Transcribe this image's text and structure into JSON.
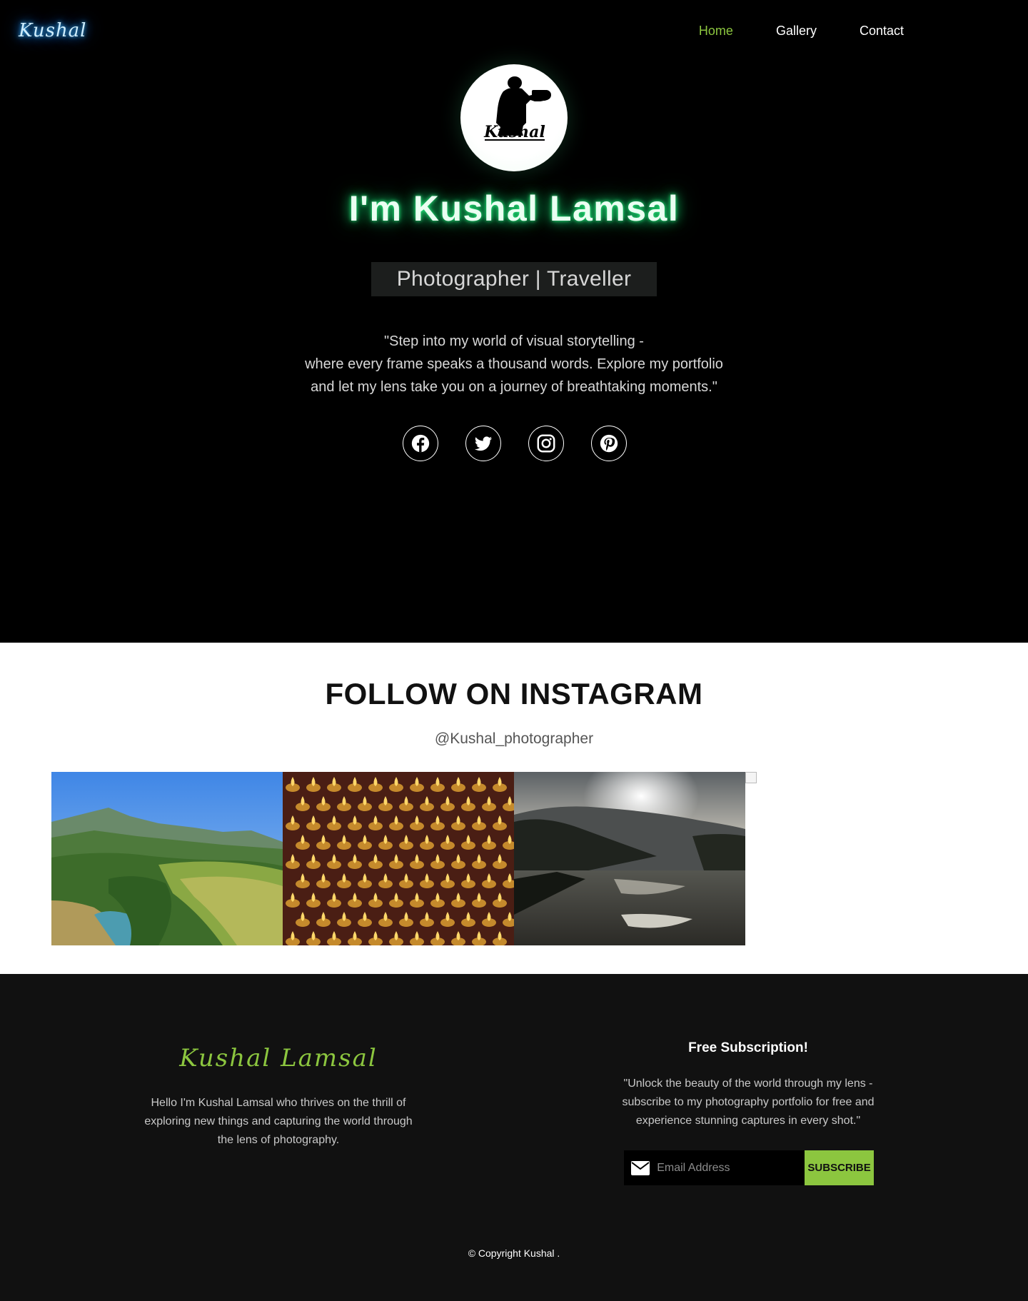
{
  "nav": {
    "logo": "Kushal",
    "links": [
      {
        "label": "Home",
        "active": true
      },
      {
        "label": "Gallery",
        "active": false
      },
      {
        "label": "Contact",
        "active": false
      }
    ],
    "active_color": "#8cc63f"
  },
  "hero": {
    "avatar_text": "Kushal",
    "title": "I'm Kushal Lamsal",
    "tagline": "Photographer | Traveller",
    "quote_lines": [
      "\"Step into my world of visual storytelling -",
      "where every frame speaks a thousand words. Explore my portfolio",
      "and let my lens take you on a journey of breathtaking moments.\""
    ],
    "socials": [
      {
        "icon": "facebook-icon"
      },
      {
        "icon": "twitter-icon"
      },
      {
        "icon": "instagram-icon"
      },
      {
        "icon": "pinterest-icon"
      }
    ],
    "glow_color": "#19c86a"
  },
  "instagram": {
    "title": "FOLLOW ON INSTAGRAM",
    "handle": "@Kushal_photographer",
    "photos": [
      "mountain-valley-photo",
      "butter-lamps-photo",
      "river-sunset-photo",
      "broken-image"
    ]
  },
  "footer": {
    "name": "Kushal Lamsal",
    "bio": "Hello I'm Kushal Lamsal who thrives on the thrill of exploring new things and capturing the world through the lens of photography.",
    "subscribe_title": "Free Subscription!",
    "subscribe_text": "\"Unlock the beauty of the world through my lens - subscribe to my photography portfolio for free and experience stunning captures in every shot.\"",
    "email_placeholder": "Email Address",
    "subscribe_button": "SUBSCRIBE",
    "copyright": "© Copyright Kushal .",
    "accent_color": "#8cc63f"
  }
}
